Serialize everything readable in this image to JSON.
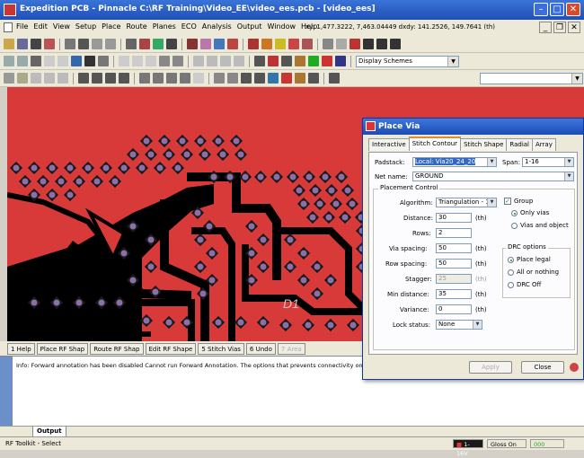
{
  "window": {
    "title": "Expedition PCB - Pinnacle C:\\RF Training\\Video_EE\\video_ees.pcb - [video_ees]"
  },
  "menu": {
    "items": [
      "File",
      "Edit",
      "View",
      "Setup",
      "Place",
      "Route",
      "Planes",
      "ECO",
      "Analysis",
      "Output",
      "Window",
      "Help"
    ],
    "coords": "xy: 1,477.3222, 7,463.04449 dxdy: 141.2526, 149.7641 (th)"
  },
  "toolbar": {
    "display_scheme": "Display Schemes"
  },
  "canvas": {
    "colors": {
      "board": "#d83a3a",
      "trace": "#000000",
      "via_fill": "#8a6fa8",
      "via_ring": "#1a1a1a"
    },
    "ref_label": "D1"
  },
  "fkeys": [
    "1 Help",
    "Place RF Shap",
    "Route RF Shap",
    "Edit RF Shape",
    "5 Stitch Vias",
    "6 Undo",
    "7 Area"
  ],
  "output": {
    "message": "Info: Forward annotation has been disabled Cannot run Forward Annotation. The options that prevents connectivity onbacki",
    "tab_label": "Output"
  },
  "status": {
    "left": "RF Toolkit - Select",
    "layer": "1-16V",
    "gloss": "Gloss On",
    "indicator": "000"
  },
  "dialog": {
    "title": "Place Via",
    "tabs": [
      "Interactive",
      "Stitch Contour",
      "Stitch Shape",
      "Radial",
      "Array"
    ],
    "active_tab": "Stitch Contour",
    "padstack": {
      "label": "Padstack:",
      "value": "Local: Via20_24_20"
    },
    "span": {
      "label": "Span:",
      "value": "1-16"
    },
    "net_name": {
      "label": "Net name:",
      "value": "GROUND"
    },
    "placement_control": "Placement Control",
    "algorithm": {
      "label": "Algorithm:",
      "value": "Triangulation - 1"
    },
    "distance": {
      "label": "Distance:",
      "value": "30",
      "unit": "(th)"
    },
    "rows": {
      "label": "Rows:",
      "value": "2"
    },
    "via_spacing": {
      "label": "Via spacing:",
      "value": "50",
      "unit": "(th)"
    },
    "row_spacing": {
      "label": "Row spacing:",
      "value": "50",
      "unit": "(th)"
    },
    "stagger": {
      "label": "Stagger:",
      "value": "25",
      "unit": "(th)"
    },
    "min_distance": {
      "label": "Min distance:",
      "value": "35",
      "unit": "(th)"
    },
    "variance": {
      "label": "Variance:",
      "value": "0",
      "unit": "(th)"
    },
    "lock_status": {
      "label": "Lock status:",
      "value": "None"
    },
    "group": {
      "label": "Group",
      "checked": true,
      "options": [
        "Only vias",
        "Vias and object"
      ],
      "selected": 0
    },
    "drc": {
      "title": "DRC options",
      "options": [
        "Place legal",
        "All or nothing",
        "DRC Off"
      ],
      "selected": 0
    },
    "buttons": {
      "apply": "Apply",
      "close": "Close"
    }
  }
}
